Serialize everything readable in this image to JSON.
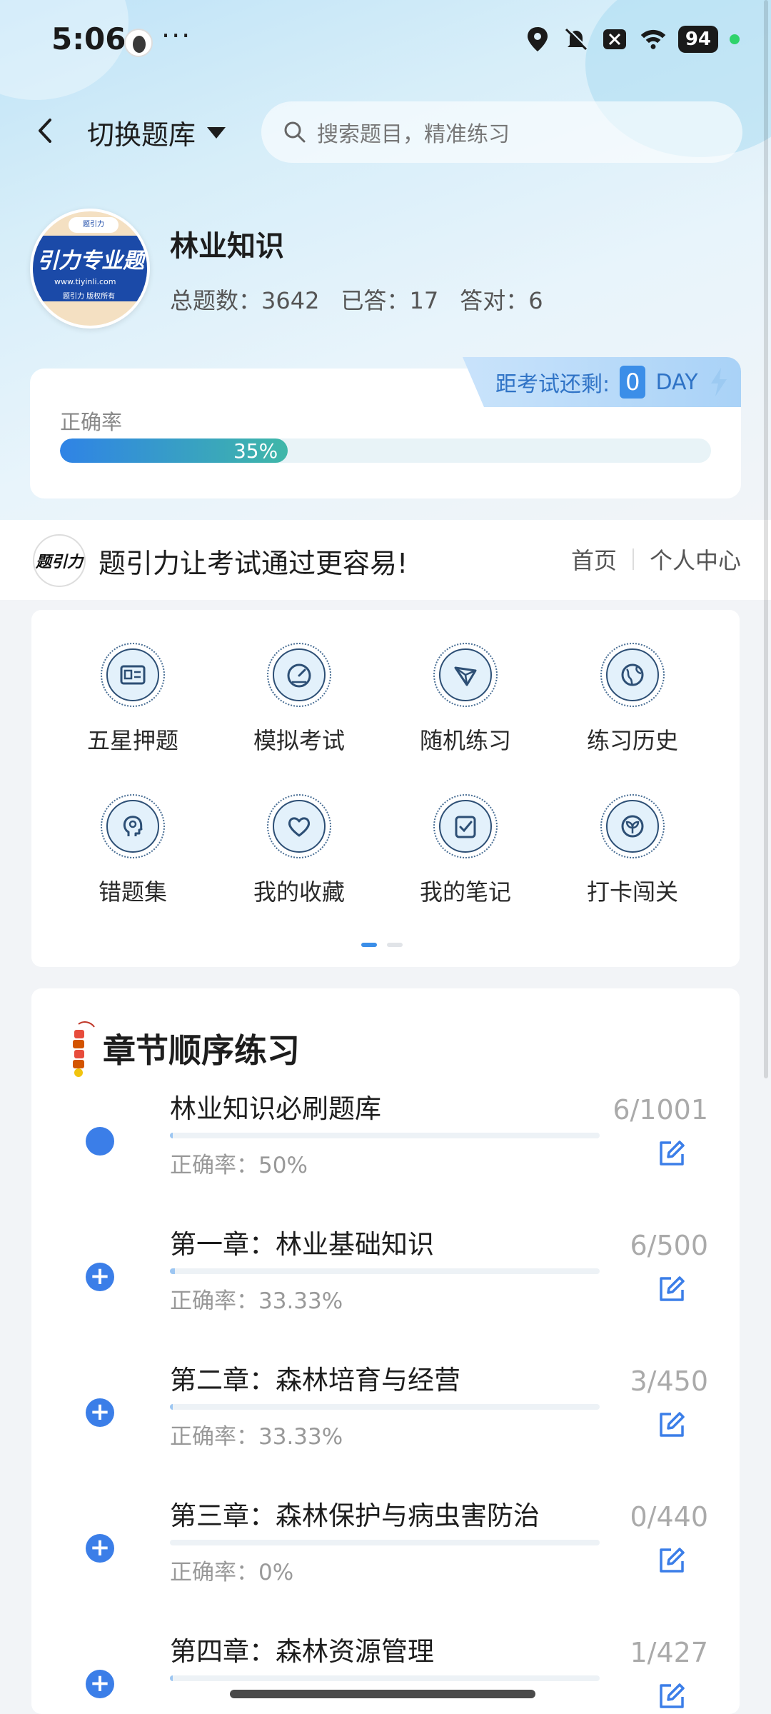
{
  "status_bar": {
    "time": "5:06",
    "more": "···",
    "battery": "94"
  },
  "header": {
    "switch_label": "切换题库",
    "search_placeholder": "搜索题目，精准练习"
  },
  "bank": {
    "logo_top": "题引力",
    "logo_main": "引力专业题",
    "logo_url": "www.tiyinli.com",
    "logo_copy": "题引力 版权所有",
    "title": "林业知识",
    "total_label": "总题数：3642",
    "answered_label": "已答：17",
    "correct_label": "答对：6"
  },
  "accuracy": {
    "countdown_label": "距考试还剩:",
    "countdown_value": "0",
    "countdown_unit": "DAY",
    "label": "正确率",
    "percent_text": "35%",
    "percent_value": 0.35
  },
  "slogan": {
    "logo_text": "题引力",
    "text": "题引力让考试通过更容易!",
    "nav_home": "首页",
    "nav_profile": "个人中心"
  },
  "grid": [
    {
      "label": "五星押题",
      "icon": "id-card-icon"
    },
    {
      "label": "模拟考试",
      "icon": "gauge-icon"
    },
    {
      "label": "随机练习",
      "icon": "network-icon"
    },
    {
      "label": "练习历史",
      "icon": "globe-icon"
    },
    {
      "label": "错题集",
      "icon": "head-icon"
    },
    {
      "label": "我的收藏",
      "icon": "heart-icon"
    },
    {
      "label": "我的笔记",
      "icon": "checklist-icon"
    },
    {
      "label": "打卡闯关",
      "icon": "plant-icon"
    }
  ],
  "chapters": {
    "title": "章节顺序练习",
    "items": [
      {
        "name": "林业知识必刷题库",
        "rate": "正确率：50%",
        "count": "6/1001",
        "progress": 0.006,
        "marker": "dot"
      },
      {
        "name": "第一章：林业基础知识",
        "rate": "正确率：33.33%",
        "count": "6/500",
        "progress": 0.012,
        "marker": "plus"
      },
      {
        "name": "第二章：森林培育与经营",
        "rate": "正确率：33.33%",
        "count": "3/450",
        "progress": 0.007,
        "marker": "plus"
      },
      {
        "name": "第三章：森林保护与病虫害防治",
        "rate": "正确率：0%",
        "count": "0/440",
        "progress": 0,
        "marker": "plus"
      },
      {
        "name": "第四章：森林资源管理",
        "rate": "",
        "count": "1/427",
        "progress": 0.002,
        "marker": "plus"
      }
    ]
  }
}
